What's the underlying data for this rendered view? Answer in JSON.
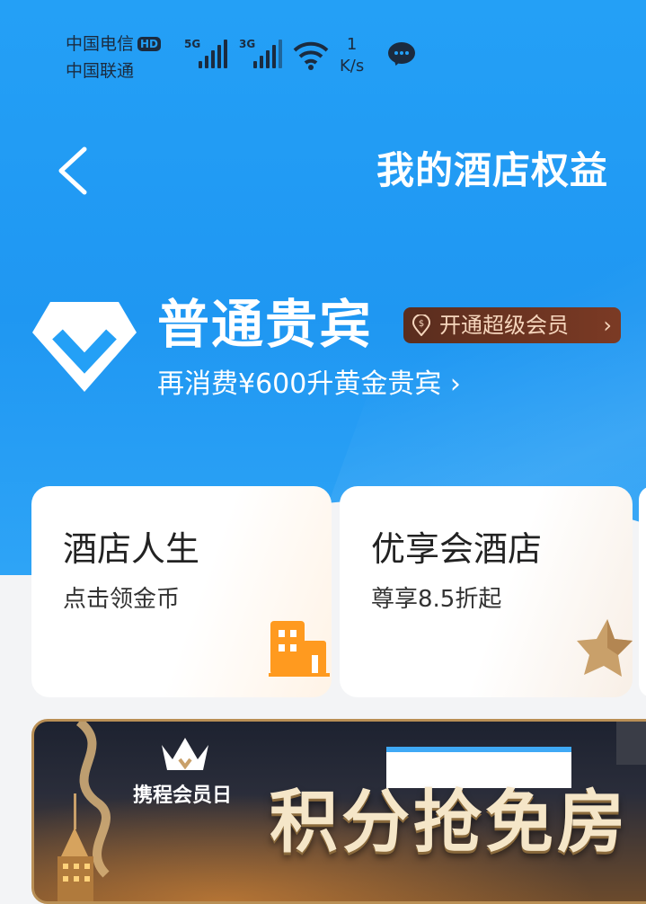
{
  "status_bar": {
    "carrier1": "中国电信",
    "hd_badge": "HD",
    "carrier2": "中国联通",
    "net1": "5G",
    "net2": "3G",
    "speed_value": "1",
    "speed_unit": "K/s"
  },
  "nav": {
    "title": "我的酒店权益"
  },
  "membership": {
    "level": "普通贵宾",
    "upgrade_label": "开通超级会员",
    "progress_text": "再消费¥600升黄金贵宾"
  },
  "cards": [
    {
      "title": "酒店人生",
      "subtitle": "点击领金币",
      "icon": "building-icon"
    },
    {
      "title": "优享会酒店",
      "subtitle": "尊享8.5折起",
      "icon": "star-icon"
    }
  ],
  "banner": {
    "member_day": "携程会员日",
    "headline": "积分抢免房"
  },
  "colors": {
    "header_blue": "#24a0f6",
    "upgrade_brown": "#6b3522",
    "building_orange": "#ff9a1f",
    "star_gold": "#c9a06a"
  }
}
